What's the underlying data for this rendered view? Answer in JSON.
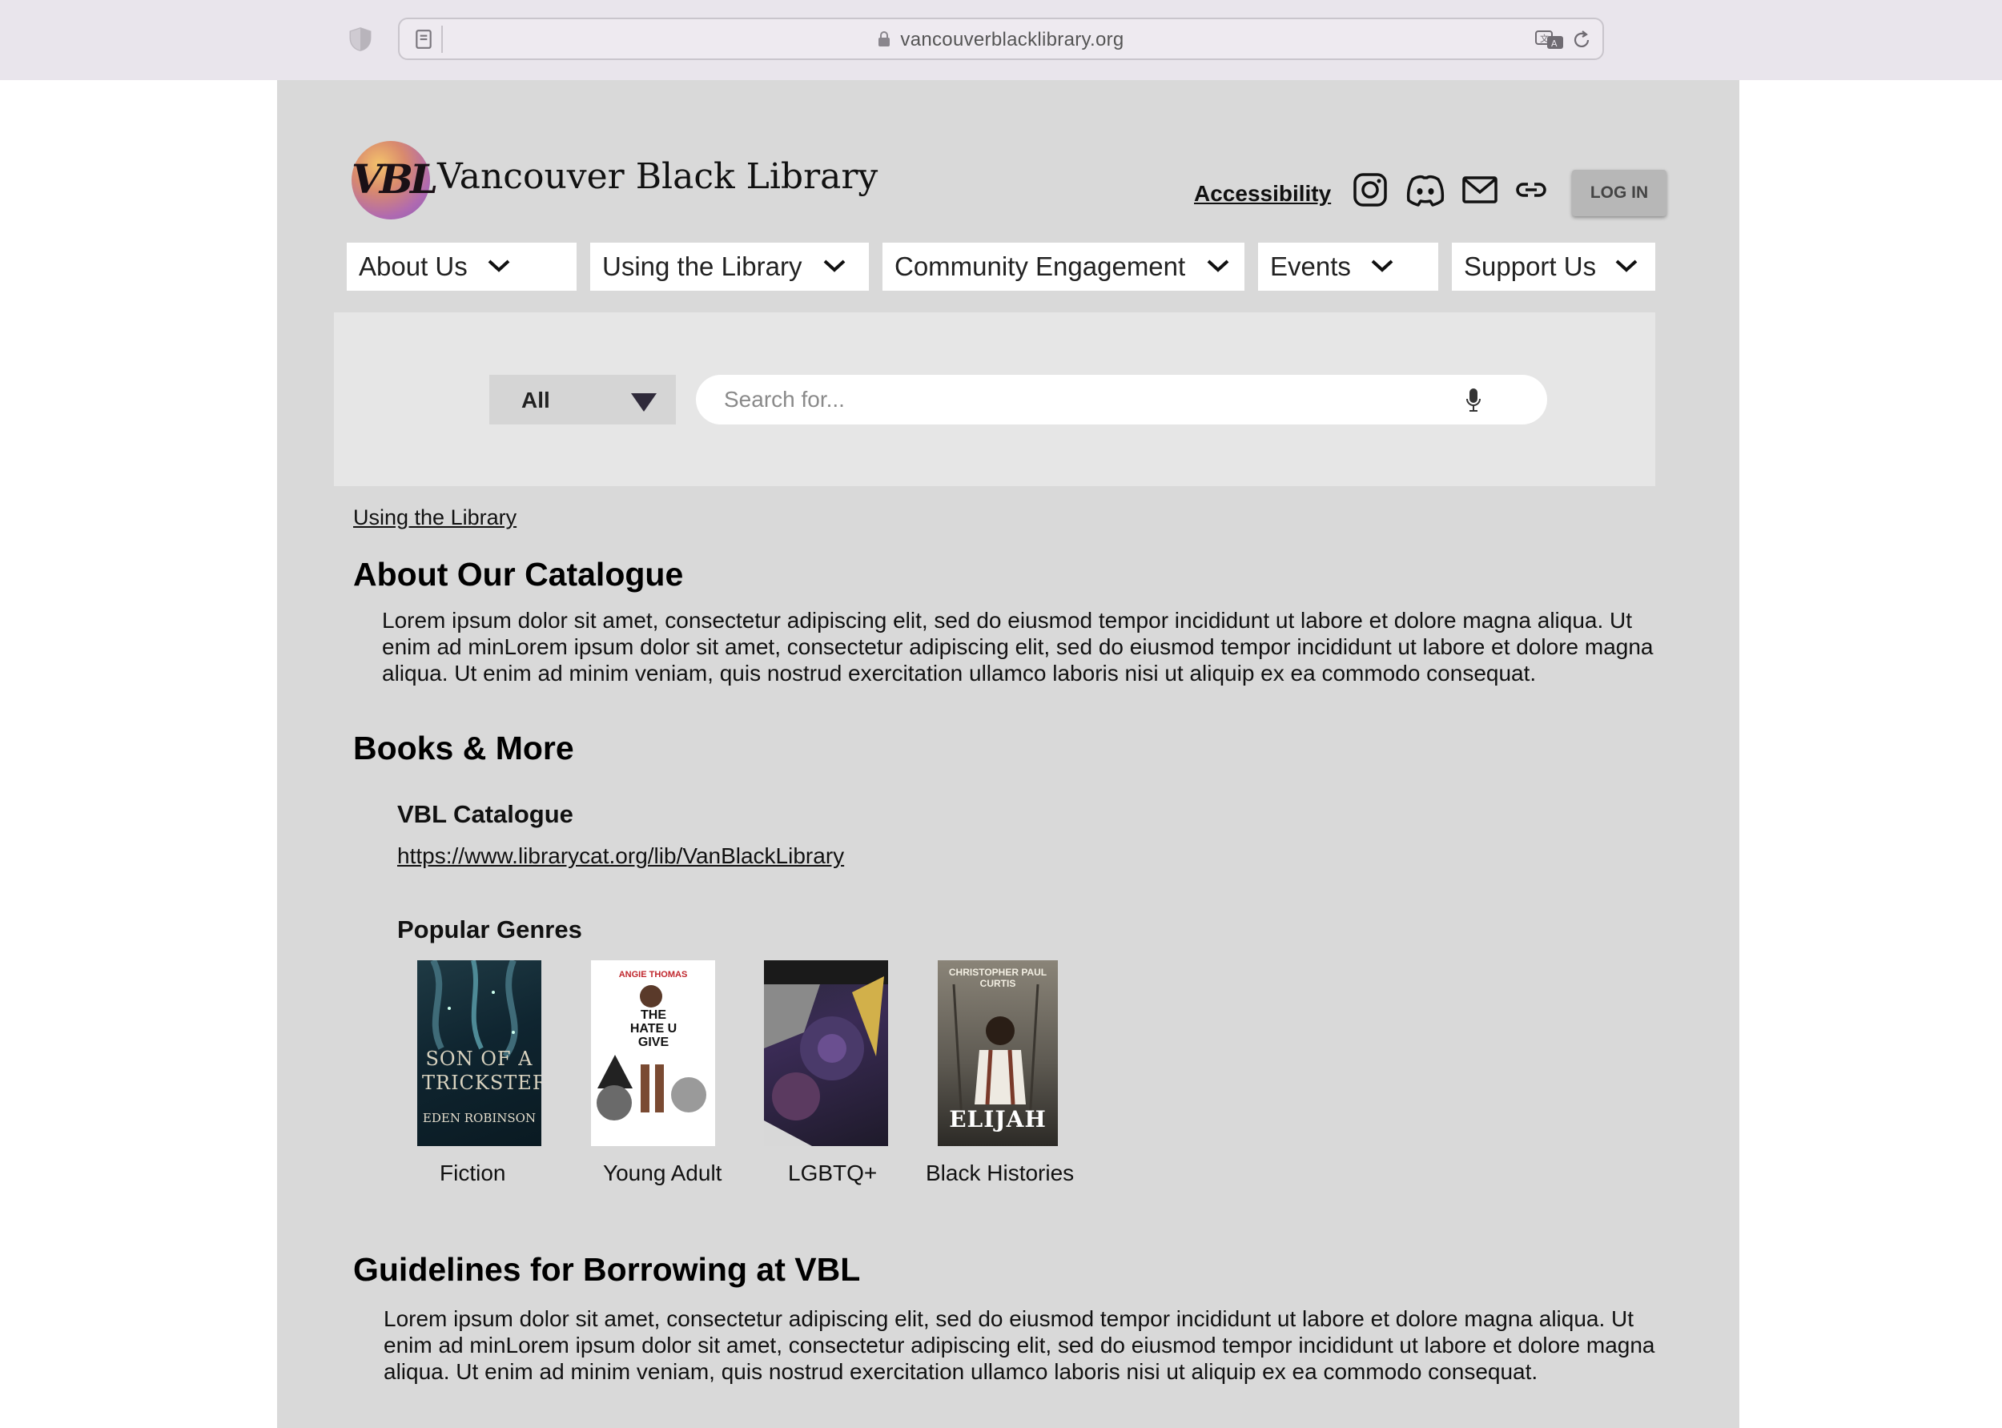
{
  "browser": {
    "url": "vancouverblacklibrary.org"
  },
  "header": {
    "logo_text": "VBL",
    "site_title": "Vancouver Black Library",
    "accessibility_label": "Accessibility",
    "social_icons": [
      "instagram-icon",
      "discord-icon",
      "mail-icon",
      "link-icon"
    ],
    "login_label": "LOG IN"
  },
  "nav": {
    "items": [
      {
        "label": "About Us"
      },
      {
        "label": "Using the Library"
      },
      {
        "label": "Community Engagement"
      },
      {
        "label": "Events"
      },
      {
        "label": "Support Us"
      }
    ]
  },
  "search": {
    "scope_selected": "All",
    "placeholder": "Search for..."
  },
  "breadcrumb": "Using the Library",
  "sections": {
    "about_catalogue": {
      "title": "About Our Catalogue",
      "body": "Lorem ipsum dolor sit amet, consectetur adipiscing elit, sed do eiusmod tempor incididunt ut labore et dolore magna aliqua. Ut enim ad minLorem ipsum dolor sit amet, consectetur adipiscing elit, sed do eiusmod tempor incididunt ut labore et dolore magna aliqua. Ut enim ad minim veniam, quis nostrud exercitation ullamco laboris nisi ut aliquip ex ea commodo consequat."
    },
    "books_more": {
      "title": "Books & More",
      "catalogue_heading": "VBL Catalogue",
      "catalogue_link": "https://www.librarycat.org/lib/VanBlackLibrary",
      "genres_heading": "Popular Genres",
      "genres": [
        {
          "label": "Fiction",
          "cover_title": "SON OF A TRICKSTER",
          "cover_author": "EDEN ROBINSON"
        },
        {
          "label": "Young Adult",
          "cover_title": "THE HATE U GIVE",
          "cover_author": "ANGIE THOMAS"
        },
        {
          "label": "LGBTQ+",
          "cover_title": "",
          "cover_author": ""
        },
        {
          "label": "Black Histories",
          "cover_title": "ELIJAH",
          "cover_author": "CHRISTOPHER PAUL CURTIS"
        }
      ]
    },
    "guidelines": {
      "title": "Guidelines for Borrowing at VBL",
      "body": "Lorem ipsum dolor sit amet, consectetur adipiscing elit, sed do eiusmod tempor incididunt ut labore et dolore magna aliqua. Ut enim ad minLorem ipsum dolor sit amet, consectetur adipiscing elit, sed do eiusmod tempor incididunt ut labore et dolore magna aliqua. Ut enim ad minim veniam, quis nostrud exercitation ullamco laboris nisi ut aliquip ex ea commodo consequat."
    }
  },
  "colors": {
    "page_bg": "#d9d9d9",
    "chrome_bg": "#e9e5ec",
    "search_panel_bg": "#e6e6e6",
    "login_bg": "#b7b7b7"
  }
}
